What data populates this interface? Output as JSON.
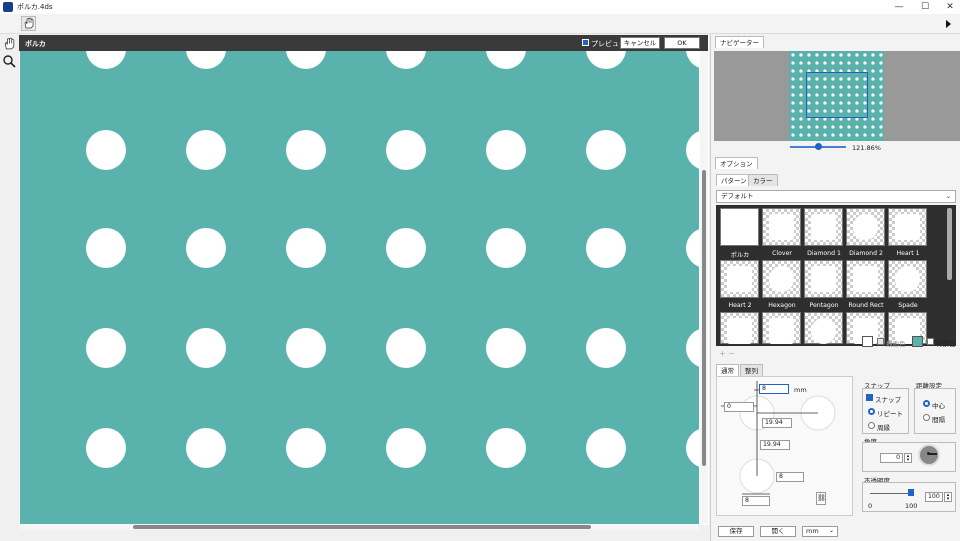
{
  "window": {
    "title": "ポルカ.4ds",
    "minimize": "—",
    "maximize": "☐",
    "close": "✕"
  },
  "colors": {
    "background": "#5ab2ad",
    "dots": "#ffffff",
    "header": "#3a3a3a",
    "accent": "#1e63c7"
  },
  "canvas": {
    "title": "ポルカ",
    "preview_label": "プレビュー",
    "preview_checked": true,
    "cancel_label": "キャンセル",
    "ok_label": "OK"
  },
  "navigator": {
    "tab": "ナビゲーター",
    "zoom": "121.86%"
  },
  "options": {
    "tab": "オプション",
    "subtabs": [
      "パターン",
      "カラー"
    ],
    "preset": "デフォルト",
    "patterns": [
      "ポルカ",
      "Clover",
      "Diamond 1",
      "Diamond 2",
      "Heart 1",
      "Heart 2",
      "Hexagon",
      "Pentagon",
      "Round Rect",
      "Spade"
    ],
    "add_remove": "+ −"
  },
  "colors_row": {
    "draw_color_label": "描画色",
    "bg_color_label": "背景色"
  },
  "layout": {
    "tabs": [
      "通常",
      "整列"
    ],
    "size_value": "8",
    "size_unit": "mm",
    "offset_x": "0",
    "spacing_x": "19.94",
    "spacing_y": "19.94",
    "dot_size_1": "8",
    "dot_size_2": "8"
  },
  "snap": {
    "title": "スナップ",
    "snap_label": "スナップ",
    "snap_checked": true,
    "repeat_label": "リピート",
    "repeat_selected": true,
    "periphery_label": "周縁"
  },
  "distance": {
    "title": "距離設定",
    "center_label": "中心",
    "center_selected": true,
    "gap_label": "間隔"
  },
  "angle": {
    "title": "角度",
    "value": "0"
  },
  "opacity": {
    "title": "不透明度",
    "value": "100",
    "min": "0",
    "max": "100",
    "level": 100
  },
  "footer": {
    "save_label": "保存",
    "open_label": "開く",
    "unit": "mm"
  }
}
